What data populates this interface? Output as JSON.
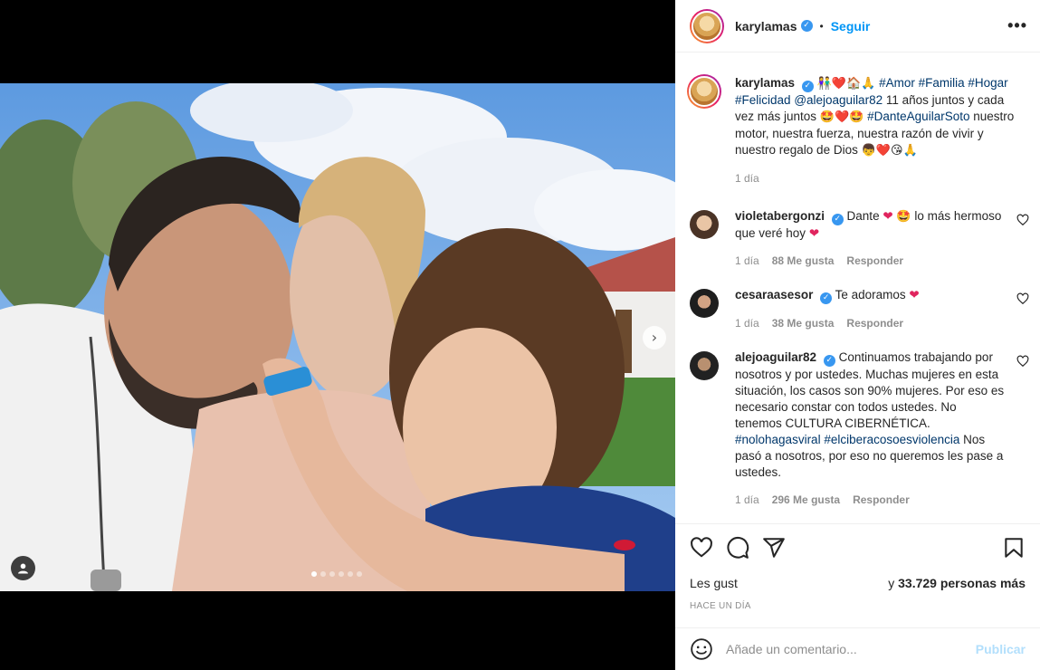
{
  "post": {
    "username": "karylamas",
    "bullet": "•",
    "follow_label": "Seguir",
    "more_label": "•••"
  },
  "caption": {
    "username": "karylamas",
    "emojis_1": "👫❤️🏠🙏",
    "tags_1": "#Amor #Familia #Hogar #Felicidad",
    "mention": "@alejoaguilar82",
    "text_1": "11 años juntos y cada vez más juntos",
    "emojis_2": "🤩❤️🤩",
    "tag_2": "#DanteAguilarSoto",
    "text_2": "nuestro motor, nuestra fuerza, nuestra razón de vivir y nuestro regalo de Dios",
    "emojis_3": "👦❤️😘🙏",
    "time": "1 día"
  },
  "comments": [
    {
      "username": "violetabergonzi",
      "text_a": "Dante",
      "heart": "❤",
      "emoji": "🤩",
      "text_b": "lo más hermoso que veré hoy",
      "time": "1 día",
      "likes": "88 Me gusta",
      "reply": "Responder"
    },
    {
      "username": "cesaraasesor",
      "text": "Te adoramos",
      "heart": "❤",
      "time": "1 día",
      "likes": "38 Me gusta",
      "reply": "Responder"
    },
    {
      "username": "alejoaguilar82",
      "text_a": "Continuamos trabajando por nosotros y por ustedes. Muchas mujeres en esta situación, los casos son 90% mujeres. Por eso es necesario constar con todos ustedes. No tenemos CULTURA CIBERNÉTICA.",
      "tags": "#nolohagasviral #elciberacosoesviolencia",
      "text_b": "Nos pasó a nosotros, por eso no queremos les pase a ustedes.",
      "time": "1 día",
      "likes": "296 Me gusta",
      "reply": "Responder"
    }
  ],
  "likes": {
    "prefix": "Les gust",
    "suffix": "y",
    "others": "33.729 personas más"
  },
  "time_ago": "HACE UN DÍA",
  "add_comment": {
    "placeholder": "Añade un comentario...",
    "publish_label": "Publicar"
  },
  "carousel": {
    "next_glyph": "›",
    "slide_count": 6,
    "active_slide": 1
  },
  "colors": {
    "accent": "#0095f6",
    "verified": "#3897f0",
    "heart": "#e0245e",
    "publish_disabled": "#b2dffc"
  },
  "icons": [
    "heart-icon",
    "comment-icon",
    "share-icon",
    "bookmark-icon",
    "emoji-icon",
    "user-tag-icon",
    "verified-icon",
    "more-icon",
    "chevron-right-icon"
  ]
}
